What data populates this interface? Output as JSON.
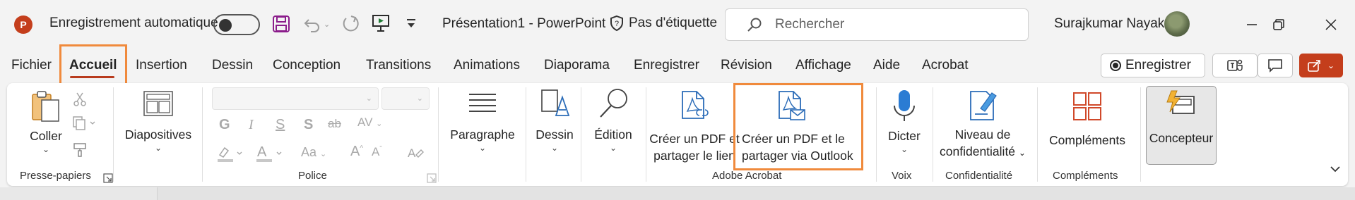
{
  "titlebar": {
    "app_icon_letter": "P",
    "autosave_label": "Enregistrement automatique",
    "document_title": "Présentation1  -  PowerPoint",
    "sensitivity_label": "Pas d'étiquette",
    "search_placeholder": "Rechercher",
    "user_name": "Surajkumar Nayak"
  },
  "tabs": [
    {
      "label": "Fichier"
    },
    {
      "label": "Accueil",
      "active": true
    },
    {
      "label": "Insertion"
    },
    {
      "label": "Dessin"
    },
    {
      "label": "Conception"
    },
    {
      "label": "Transitions"
    },
    {
      "label": "Animations"
    },
    {
      "label": "Diaporama"
    },
    {
      "label": "Enregistrer"
    },
    {
      "label": "Révision"
    },
    {
      "label": "Affichage"
    },
    {
      "label": "Aide"
    },
    {
      "label": "Acrobat"
    }
  ],
  "record_button": "Enregistrer",
  "ribbon": {
    "clipboard": {
      "paste": "Coller",
      "group": "Presse-papiers"
    },
    "slides": {
      "label": "Diapositives"
    },
    "font": {
      "group": "Police"
    },
    "paragraph": {
      "label": "Paragraphe"
    },
    "drawing": {
      "label": "Dessin"
    },
    "editing": {
      "label": "Édition"
    },
    "acrobat": {
      "pdf_link_line1": "Créer un PDF et",
      "pdf_link_line2": "partager le lien",
      "pdf_outlook_line1": "Créer un PDF et le",
      "pdf_outlook_line2": "partager via Outlook",
      "group": "Adobe Acrobat"
    },
    "voice": {
      "dictate": "Dicter",
      "group": "Voix"
    },
    "sensitivity": {
      "line1": "Niveau de",
      "line2": "confidentialité",
      "group": "Confidentialité"
    },
    "addins": {
      "label": "Compléments",
      "group": "Compléments"
    },
    "designer": {
      "label": "Concepteur"
    }
  },
  "colors": {
    "accent": "#c43e1c",
    "highlight_box": "#f08a3c",
    "pdf_blue": "#2b6cb8"
  }
}
